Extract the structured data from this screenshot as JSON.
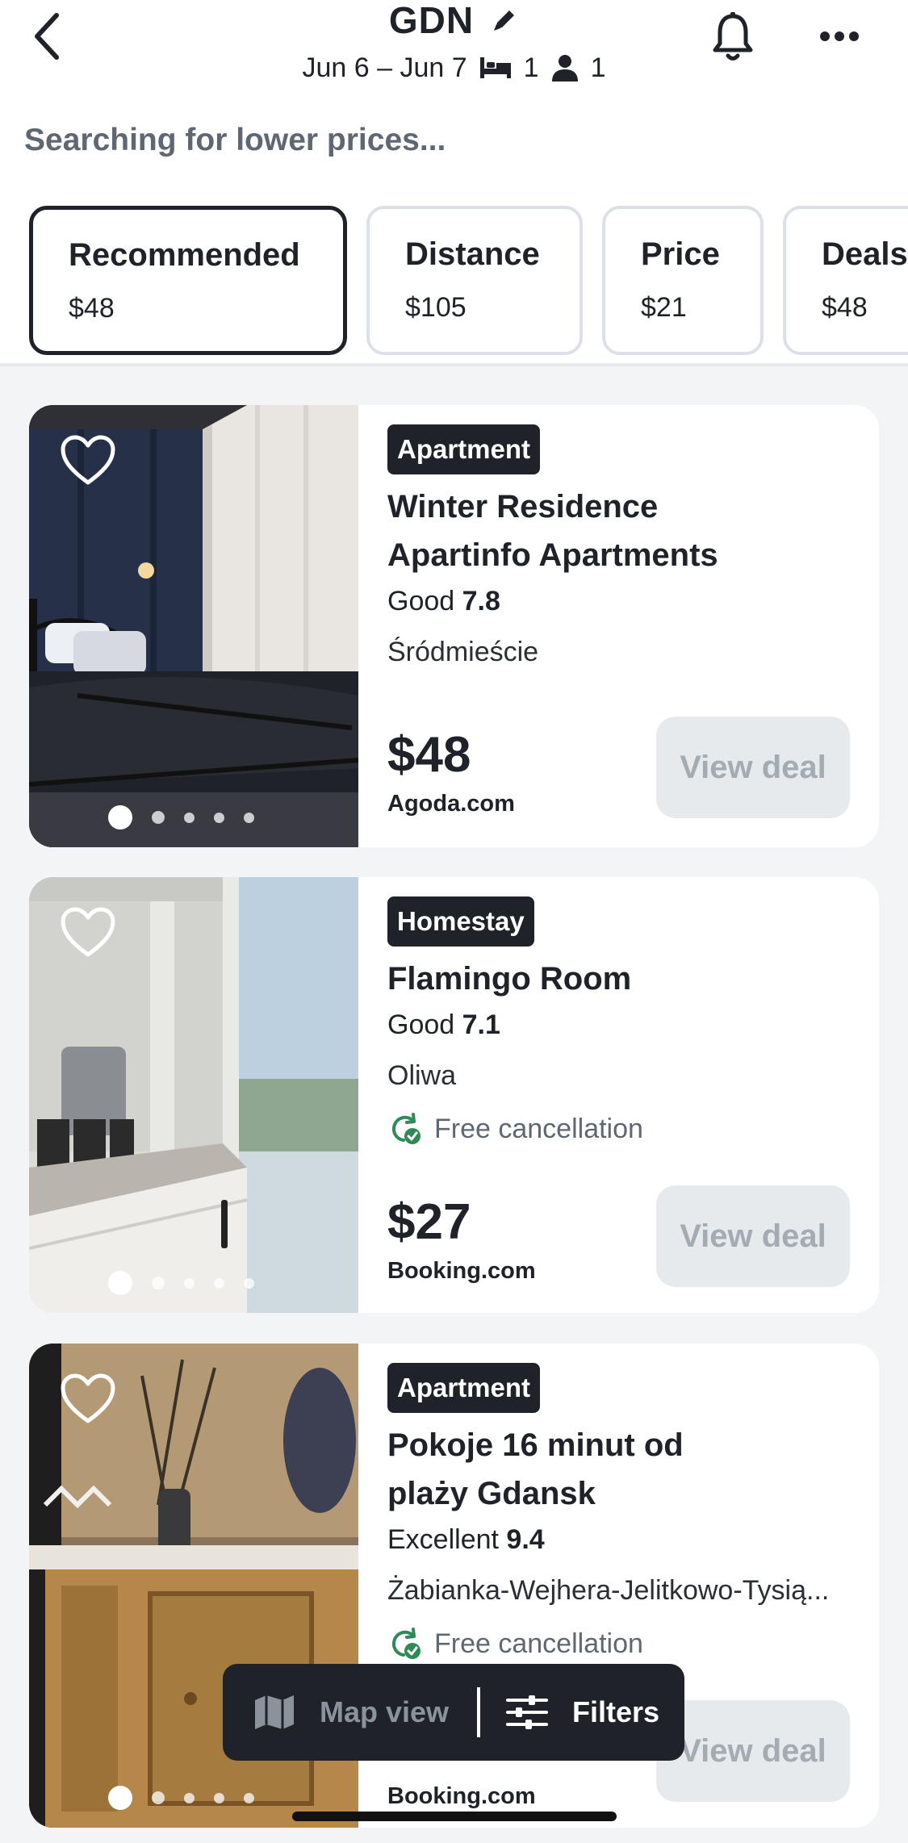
{
  "header": {
    "title": "GDN",
    "dates": "Jun 6 – Jun 7",
    "rooms": "1",
    "guests": "1"
  },
  "status_text": "Searching for lower prices...",
  "sort_tabs": [
    {
      "label": "Recommended",
      "price": "$48",
      "active": true
    },
    {
      "label": "Distance",
      "price": "$105",
      "active": false
    },
    {
      "label": "Price",
      "price": "$21",
      "active": false
    },
    {
      "label": "Deals",
      "price": "$48",
      "active": false
    }
  ],
  "listings": [
    {
      "type": "Apartment",
      "name_lines": [
        "Winter Residence",
        "Apartinfo Apartments"
      ],
      "rating_word": "Good",
      "rating_score": "7.8",
      "area": "Śródmieście",
      "free_cancellation": "",
      "price": "$48",
      "site": "Agoda.com",
      "cta": "View deal",
      "photo_count": 5,
      "photo_index": 1
    },
    {
      "type": "Homestay",
      "name_lines": [
        "Flamingo Room"
      ],
      "rating_word": "Good",
      "rating_score": "7.1",
      "area": "Oliwa",
      "free_cancellation": "Free cancellation",
      "price": "$27",
      "site": "Booking.com",
      "cta": "View deal",
      "photo_count": 5,
      "photo_index": 1
    },
    {
      "type": "Apartment",
      "name_lines": [
        "Pokoje 16 minut od",
        "plaży Gdansk"
      ],
      "rating_word": "Excellent",
      "rating_score": "9.4",
      "area": "Żabianka-Wejhera-Jelitkowo-Tysią...",
      "free_cancellation": "Free cancellation",
      "price": "",
      "site": "Booking.com",
      "cta": "View deal",
      "photo_count": 5,
      "photo_index": 1
    }
  ],
  "floating_bar": {
    "map_label": "Map view",
    "filters_label": "Filters"
  },
  "colors": {
    "text": "#1f2329",
    "muted": "#5f6872",
    "accent_green": "#2e8b57",
    "button_disabled_bg": "#e7eaed",
    "button_disabled_text": "#a3abb3"
  }
}
